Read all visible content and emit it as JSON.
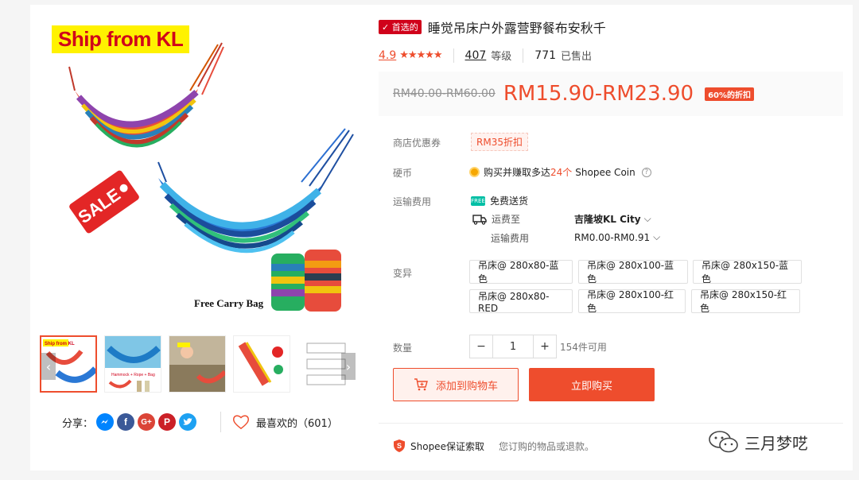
{
  "gallery": {
    "ship_tag": "Ship from KL",
    "sale_tag": "SALE",
    "carry_label": "Free Carry Bag",
    "thumb_labels": {
      "t1_tag": "Ship from KL",
      "t2_caption": "Hammock + Rope + Bag"
    }
  },
  "share": {
    "label": "分享：",
    "icons": [
      "messenger-icon",
      "facebook-icon",
      "google-plus-icon",
      "pinterest-icon",
      "twitter-icon"
    ],
    "colors": {
      "messenger": "#0084ff",
      "facebook": "#3b5998",
      "google": "#db4437",
      "pinterest": "#cb2027",
      "twitter": "#1da1f2"
    }
  },
  "like": {
    "label": "最喜欢的（601）"
  },
  "product": {
    "badge": "首选的",
    "title": "睡觉吊床户外露营野餐布安秋千",
    "rating": "4.9",
    "stars": "★★★★★",
    "ratings_count": "407",
    "ratings_label": "等级",
    "sold_count": "771",
    "sold_label": "已售出"
  },
  "price": {
    "original": "RM40.00-RM60.00",
    "current": "RM15.90-RM23.90",
    "discount": "60%的折扣"
  },
  "details": {
    "voucher_label": "商店优惠券",
    "voucher_value": "RM35折扣",
    "coins_label": "硬币",
    "coins_text_pre": "购买并赚取多达",
    "coins_amount": "24个",
    "coins_text_post": "Shopee Coin",
    "shipping_label": "运输费用",
    "free_shipping_text": "免费送货",
    "ship_to_label": "运费至",
    "ship_to_value": "吉隆坡KL City",
    "ship_fee_label": "运输费用",
    "ship_fee_value": "RM0.00-RM0.91",
    "variation_label": "变异",
    "variations": [
      "吊床@ 280x80-蓝色",
      "吊床@ 280x100-蓝色",
      "吊床@ 280x150-蓝色",
      "吊床@ 280x80-RED",
      "吊床@ 280x100-红色",
      "吊床@ 280x150-红色"
    ],
    "quantity_label": "数量",
    "quantity_value": "1",
    "minus": "−",
    "plus": "+",
    "available": "154件可用"
  },
  "actions": {
    "add_to_cart": "添加到购物车",
    "buy_now": "立即购买"
  },
  "guarantee": {
    "title": "Shopee保证索取",
    "subtitle": "您订购的物品或退款。"
  },
  "watermark": {
    "text": "三月梦呓"
  },
  "colors": {
    "accent": "#ee4d2d",
    "badge": "#d0011b"
  }
}
